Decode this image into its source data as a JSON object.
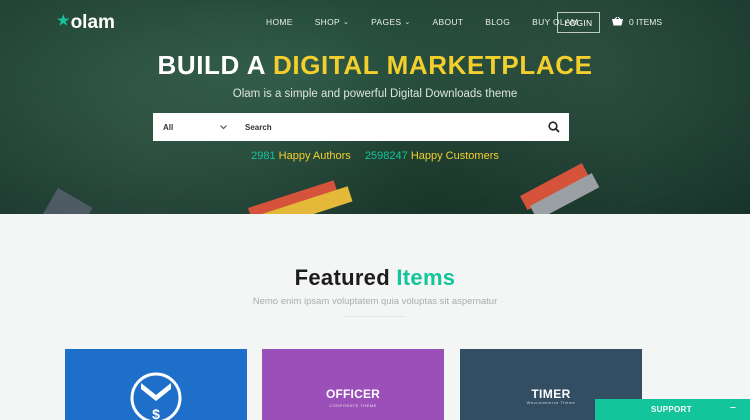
{
  "brand": {
    "logo_text": "olam",
    "logo_icon": "star-icon",
    "accent": "#14c49a",
    "highlight": "#f2cf2c"
  },
  "nav": {
    "items": [
      {
        "label": "HOME",
        "has_dropdown": false
      },
      {
        "label": "SHOP",
        "has_dropdown": true
      },
      {
        "label": "PAGES",
        "has_dropdown": true
      },
      {
        "label": "ABOUT",
        "has_dropdown": false
      },
      {
        "label": "BLOG",
        "has_dropdown": false
      },
      {
        "label": "BUY OLAM",
        "has_dropdown": false
      }
    ],
    "login_label": "LOGIN",
    "cart_label": "0 ITEMS",
    "cart_icon": "basket-icon"
  },
  "hero": {
    "headline_part1": "BUILD A",
    "headline_part2": "DIGITAL MARKETPLACE",
    "subtitle": "Olam is a simple and powerful Digital Downloads theme",
    "search": {
      "category_value": "All",
      "placeholder": "Search"
    },
    "stats": {
      "authors_count": "2981",
      "authors_label": "Happy Authors",
      "customers_count": "2598247",
      "customers_label": "Happy Customers"
    }
  },
  "featured": {
    "title_part1": "Featured",
    "title_part2": "Items",
    "subtitle": "Nemo enim ipsam voluptatem quia voluptas sit aspernatur",
    "cards": [
      {
        "title": "",
        "subtitle": "",
        "color": "#1e6fc9",
        "icon": "dollar-download-icon"
      },
      {
        "title": "OFFICER",
        "subtitle": "CORPORATE THEME",
        "color": "#9b4fb8"
      },
      {
        "title": "TIMER",
        "subtitle": "Woocommerce Theme",
        "color": "#334d63"
      }
    ]
  },
  "support": {
    "label": "SUPPORT",
    "toggle": "–"
  }
}
